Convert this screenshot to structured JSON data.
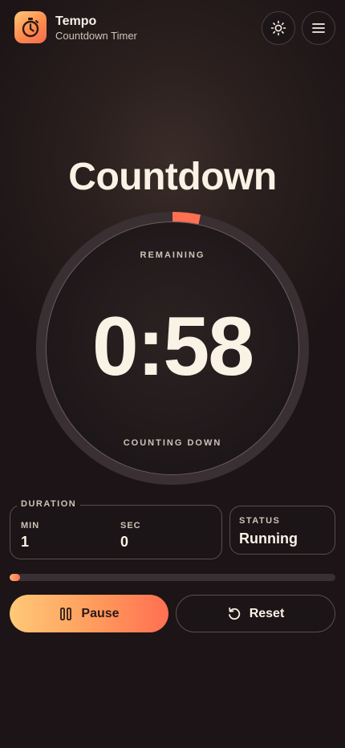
{
  "app": {
    "name": "Tempo",
    "subtitle": "Countdown Timer"
  },
  "header": {
    "theme_icon": "sun-icon",
    "menu_icon": "hamburger-menu-icon"
  },
  "timer": {
    "mode_title": "Countdown",
    "remaining_label": "REMAINING",
    "time": "0:58",
    "state_label": "COUNTING DOWN",
    "progress": 0.033,
    "accent": "#ff6f52"
  },
  "duration": {
    "legend": "DURATION",
    "min_label": "MIN",
    "min_value": "1",
    "sec_label": "SEC",
    "sec_value": "0"
  },
  "status": {
    "label": "STATUS",
    "value": "Running"
  },
  "controls": {
    "pause_label": "Pause",
    "pause_icon": "pause-icon",
    "reset_label": "Reset",
    "reset_icon": "reset-icon"
  }
}
